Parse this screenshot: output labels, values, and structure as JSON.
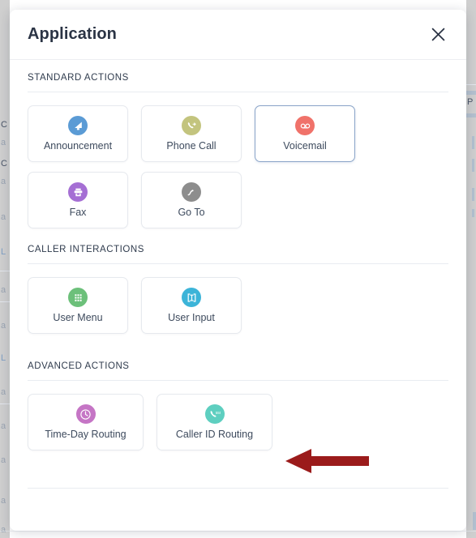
{
  "modal": {
    "title": "Application",
    "close_icon": "close-icon",
    "sections": [
      {
        "id": "standard-actions",
        "title": "STANDARD ACTIONS",
        "rows": [
          [
            {
              "label": "Announcement",
              "icon": "announcement-icon",
              "color": "#5b9bd5",
              "selected": false
            },
            {
              "label": "Phone Call",
              "icon": "phone-call-icon",
              "color": "#c3c47e",
              "selected": false
            },
            {
              "label": "Voicemail",
              "icon": "voicemail-icon",
              "color": "#f0726a",
              "selected": true
            }
          ],
          [
            {
              "label": "Fax",
              "icon": "fax-icon",
              "color": "#a56fd4",
              "selected": false
            },
            {
              "label": "Go To",
              "icon": "go-to-icon",
              "color": "#8d8d8d",
              "selected": false
            }
          ]
        ]
      },
      {
        "id": "caller-interactions",
        "title": "CALLER INTERACTIONS",
        "rows": [
          [
            {
              "label": "User Menu",
              "icon": "user-menu-icon",
              "color": "#6cc07a",
              "selected": false
            },
            {
              "label": "User Input",
              "icon": "user-input-icon",
              "color": "#3cb4d8",
              "selected": false
            }
          ]
        ]
      },
      {
        "id": "advanced-actions",
        "title": "ADVANCED ACTIONS",
        "rows": [
          [
            {
              "label": "Time-Day Routing",
              "icon": "clock-icon",
              "color": "#c575c5",
              "selected": false
            },
            {
              "label": "Caller ID Routing",
              "icon": "caller-id-icon",
              "color": "#5ecfc0",
              "selected": false
            }
          ]
        ]
      }
    ]
  },
  "annotation": {
    "name": "red-arrow-pointer",
    "color": "#9b1b1b",
    "direction": "left"
  },
  "background": {
    "left_fragments": [
      "C",
      "a",
      "C",
      "a",
      "a",
      "L",
      "a",
      "a",
      "L",
      "a",
      "a",
      "a"
    ],
    "right_fragments": [
      "P"
    ]
  }
}
